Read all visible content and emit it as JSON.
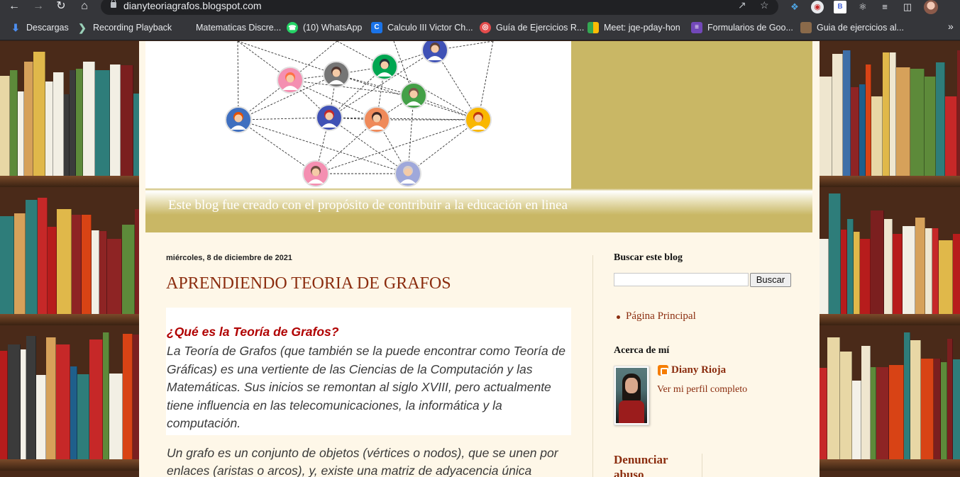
{
  "browser": {
    "url": "dianyteoriagrafos.blogspot.com",
    "bookmarks": [
      {
        "label": "Descargas",
        "icon": "download-icon",
        "color": "#4d8ef0"
      },
      {
        "label": "Recording Playback",
        "icon": "recording-icon",
        "color": "#5e9e88"
      },
      {
        "label": "Matematicas Discre...",
        "icon": "page-icon",
        "color": "#35363a"
      },
      {
        "label": "(10) WhatsApp",
        "icon": "whatsapp-icon",
        "color": "#25d366"
      },
      {
        "label": "Calculo III Victor Ch...",
        "icon": "classroom-icon",
        "color": "#1a73e8"
      },
      {
        "label": "Guía de Ejercicios R...",
        "icon": "target-icon",
        "color": "#e34c4c"
      },
      {
        "label": "Meet: jqe-pday-hon",
        "icon": "meet-icon",
        "color": "#00897b"
      },
      {
        "label": "Formularios de Goo...",
        "icon": "forms-icon",
        "color": "#7248b9"
      },
      {
        "label": "Guia de ejercicios al...",
        "icon": "photo-icon",
        "color": "#8a6a4a"
      }
    ]
  },
  "blog": {
    "description": "Este blog fue creado con el propósito de contribuir a la educación en linea",
    "post": {
      "date": "miércoles, 8 de diciembre de 2021",
      "title": "APRENDIENDO TEORIA DE GRAFOS",
      "question": "¿Qué es la Teoría de Grafos?",
      "paragraph1": "La Teoría de Grafos (que también se la puede encontrar como Teoría de Gráficas) es una vertiente de las Ciencias de la Computación y las Matemáticas. Sus inicios se remontan al siglo XVIII, pero actualmente tiene influencia en las telecomunicaciones, la informática y la computación.",
      "paragraph2": "Un grafo es un conjunto de objetos (vértices o nodos), que se unen por enlaces (aristas o arcos), y, existe una matriz de adyacencia única"
    },
    "sidebar": {
      "search_title": "Buscar este blog",
      "search_button": "Buscar",
      "pages_link": "Página Principal",
      "about_title": "Acerca de mí",
      "author_name": "Diany Rioja",
      "profile_link": "Ver mi perfil completo",
      "report_title": "Denunciar abuso"
    }
  },
  "colors": {
    "accent": "#8b2d0f",
    "header_olive": "#c9b765",
    "page_bg": "#fef7e8",
    "question_red": "#b00000"
  }
}
